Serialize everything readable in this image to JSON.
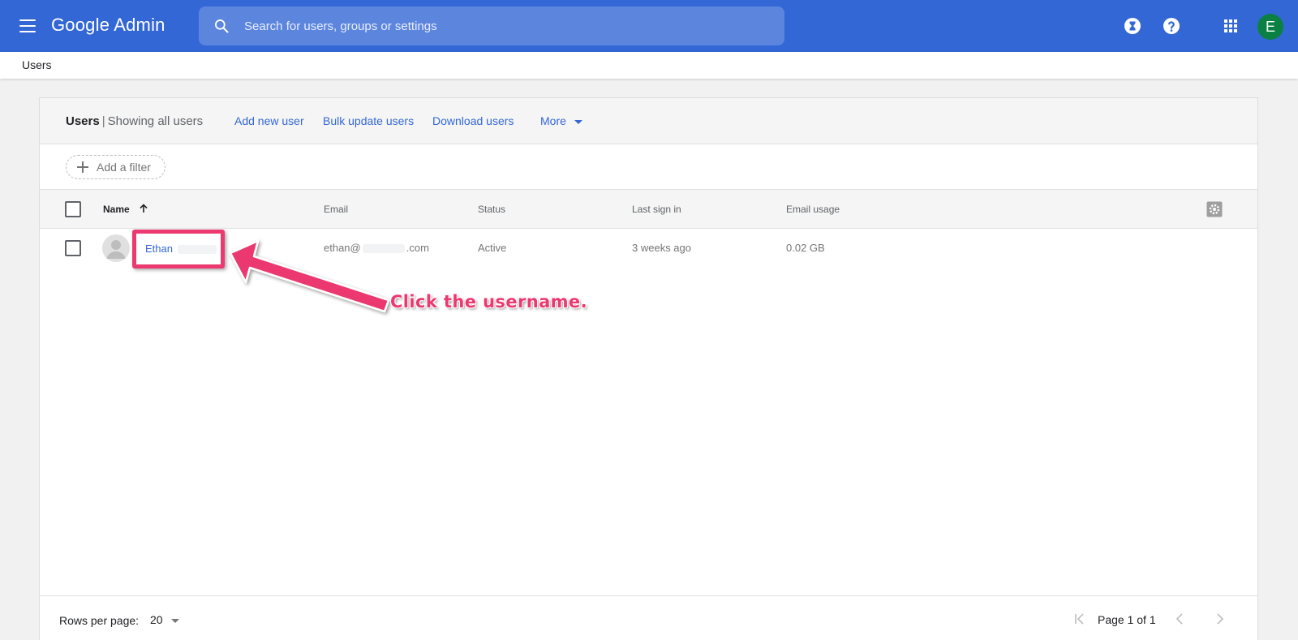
{
  "app": {
    "logo": "Google Admin",
    "search_placeholder": "Search for users, groups or settings",
    "account_initial": "E",
    "accent_color": "#3367d6",
    "icons": [
      "menu-icon",
      "search-icon",
      "hourglass-icon",
      "help-icon",
      "apps-grid-icon"
    ]
  },
  "breadcrumb": {
    "current": "Users"
  },
  "header": {
    "title": "Users",
    "separator": "|",
    "subtitle": "Showing all users",
    "actions": {
      "add_new_user": "Add new user",
      "bulk_update_users": "Bulk update users",
      "download_users": "Download users",
      "more": "More"
    }
  },
  "filter": {
    "label": "Add a filter"
  },
  "table": {
    "columns": {
      "name": "Name",
      "email": "Email",
      "status": "Status",
      "last_sign_in": "Last sign in",
      "email_usage": "Email usage"
    },
    "rows": [
      {
        "name": "Ethan",
        "email_prefix": "ethan@",
        "email_suffix": ".com",
        "status": "Active",
        "last_sign_in": "3 weeks ago",
        "email_usage": "0.02 GB"
      }
    ]
  },
  "footer": {
    "rows_per_page_label": "Rows per page:",
    "rows_per_page_value": "20",
    "page_text": "Page 1 of 1"
  },
  "annotation": {
    "text": "Click the username.",
    "color": "#ec3970"
  }
}
